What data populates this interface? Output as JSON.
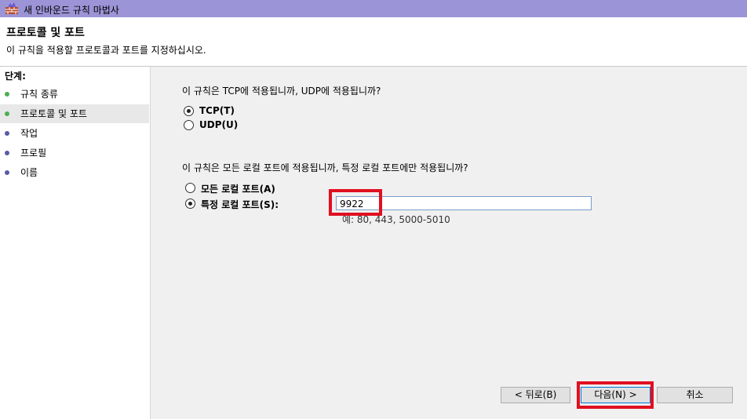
{
  "window": {
    "title": "새 인바운드 규칙 마법사"
  },
  "header": {
    "title": "프로토콜 및 포트",
    "subtitle": "이 규칙을 적용할 프로토콜과 포트를 지정하십시오."
  },
  "sidebar": {
    "steps_label": "단계:",
    "items": [
      {
        "label": "규칙 종류",
        "status": "done"
      },
      {
        "label": "프로토콜 및 포트",
        "status": "done"
      },
      {
        "label": "작업",
        "status": "todo"
      },
      {
        "label": "프로필",
        "status": "todo"
      },
      {
        "label": "이름",
        "status": "todo"
      }
    ]
  },
  "protocol": {
    "question": "이 규칙은 TCP에 적용됩니까, UDP에 적용됩니까?",
    "tcp_label": "TCP(T)",
    "udp_label": "UDP(U)",
    "selected": "TCP"
  },
  "ports": {
    "question": "이 규칙은 모든 로컬 포트에 적용됩니까, 특정 로컬 포트에만 적용됩니까?",
    "all_label": "모든 로컬 포트(A)",
    "specific_label": "특정 로컬 포트(S):",
    "selected": "specific",
    "value": "9922",
    "hint": "예: 80, 443, 5000-5010"
  },
  "buttons": {
    "back": "< 뒤로(B)",
    "next": "다음(N) >",
    "cancel": "취소"
  },
  "colors": {
    "titlebar": "#9b94d6",
    "highlight": "#e01020",
    "step_done": "#4caf50",
    "step_todo": "#5a5aa8"
  }
}
